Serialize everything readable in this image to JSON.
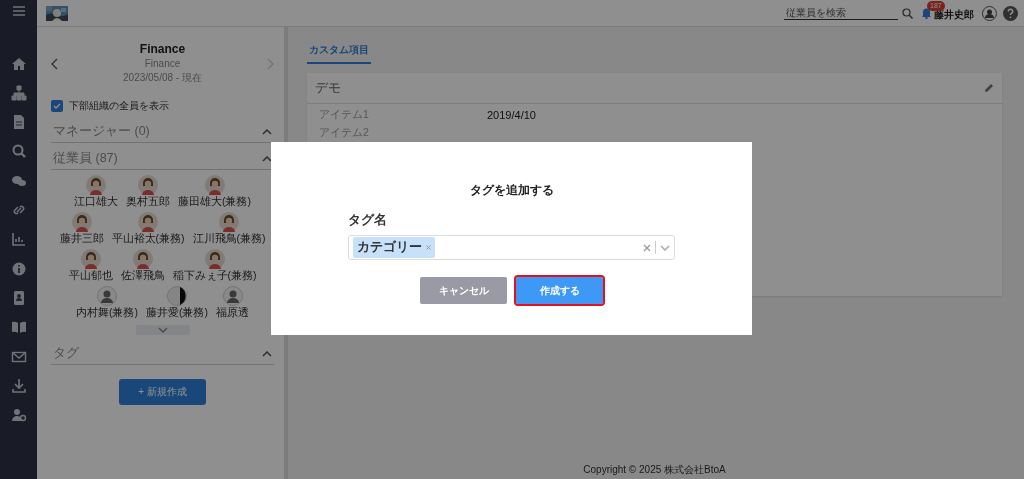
{
  "topbar": {
    "search": {
      "placeholder": "従業員を検索"
    },
    "notifications": {
      "count": "187"
    },
    "user": {
      "name": "藤井史郎"
    }
  },
  "org": {
    "title": "Finance",
    "subtitle": "Finance",
    "period": "2023/05/08 - 現在",
    "prev_disabled": false,
    "next_disabled": true,
    "show_all": {
      "label": "下部組織の全員を表示",
      "checked": true
    },
    "sections": [
      {
        "title": "マネージャー (0)",
        "expanded": true
      },
      {
        "title": "従業員 (87)",
        "expanded": true,
        "members": [
          {
            "name": "江口雄大",
            "kind": "illustration"
          },
          {
            "name": "奥村五郎",
            "kind": "illustration"
          },
          {
            "name": "藤田雄大(兼務)",
            "kind": "illustration"
          },
          {
            "name": "藤井三郎",
            "kind": "illustration"
          },
          {
            "name": "平山裕太(兼務)",
            "kind": "illustration"
          },
          {
            "name": "江川飛鳥(兼務)",
            "kind": "illustration"
          },
          {
            "name": "平山郁也",
            "kind": "illustration"
          },
          {
            "name": "佐澤飛鳥",
            "kind": "illustration"
          },
          {
            "name": "稲下みぇ子(兼務)",
            "kind": "illustration"
          },
          {
            "name": "内村舞(兼務)",
            "kind": "placeholder"
          },
          {
            "name": "藤井愛(兼務)",
            "kind": "half"
          },
          {
            "name": "福原透",
            "kind": "placeholder"
          }
        ]
      },
      {
        "title": "タグ",
        "expanded": true
      }
    ],
    "new_button": "+ 新規作成"
  },
  "main": {
    "tabs": [
      {
        "label": "カスタム項目",
        "selected": true
      }
    ],
    "card": {
      "title": "デモ",
      "rows": [
        {
          "label": "アイテム1",
          "value": "2019/4/10"
        },
        {
          "label": "アイテム2"
        }
      ]
    },
    "footer": "Copyright © 2025 株式会社BtoA"
  },
  "dialog": {
    "title": "タグを追加する",
    "field_label": "タグ名",
    "tags": [
      "カテゴリー"
    ],
    "buttons": [
      {
        "label": "キャンセル",
        "kind": "secondary",
        "highlighted": false
      },
      {
        "label": "作成する",
        "kind": "primary",
        "highlighted": true
      }
    ]
  }
}
